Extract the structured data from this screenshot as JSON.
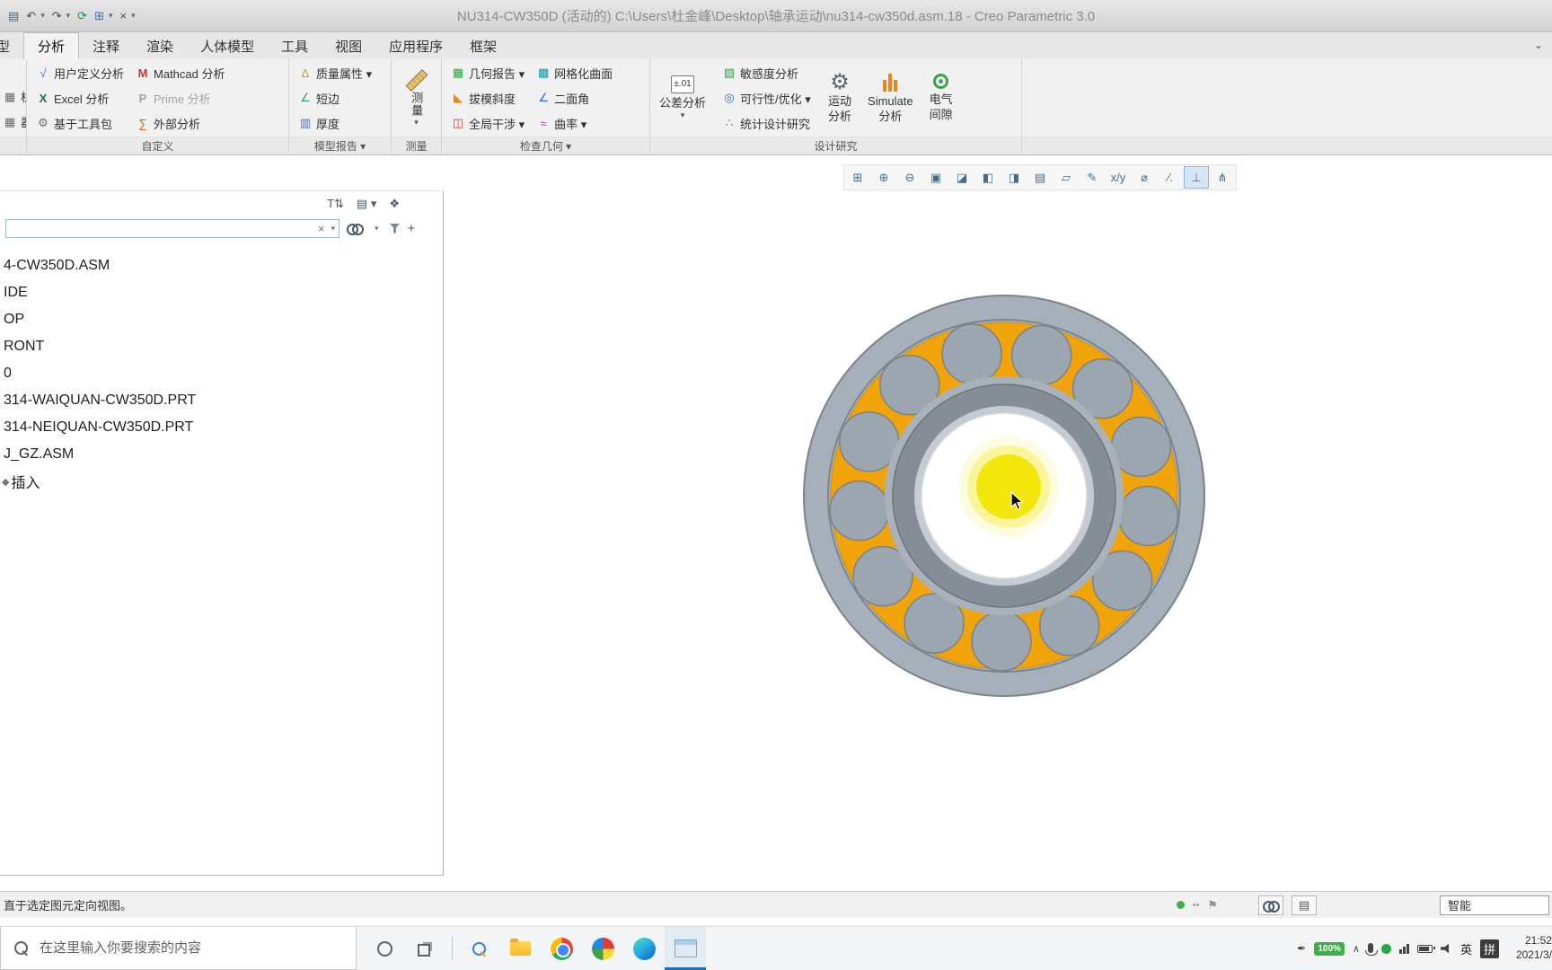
{
  "colors": {
    "bearing_outer": "#a6b0ba",
    "bearing_orange": "#f1a30a",
    "bearing_roller": "#9ba6b0",
    "bearing_gap": "#a9b2bb",
    "bearing_inner_dark": "#858d97",
    "bearing_inner_light": "#c4cbd2",
    "highlight_yellow": "#f2e60a",
    "accent_blue": "#0078d7",
    "status_green": "#3fae49"
  },
  "titlebar": {
    "title": "NU314-CW350D (活动的) C:\\Users\\杜金峰\\Desktop\\轴承运动\\nu314-cw350d.asm.18 - Creo Parametric 3.0",
    "quick_icons": [
      {
        "name": "file-icon",
        "glyph": "▤",
        "icon": "file"
      },
      {
        "name": "undo-button",
        "glyph": "↶",
        "icon": "undo"
      },
      {
        "name": "undo-dropdown",
        "glyph": "▾",
        "icon": "drop"
      },
      {
        "name": "redo-button",
        "glyph": "↷",
        "icon": "redo"
      },
      {
        "name": "redo-dropdown",
        "glyph": "▾",
        "icon": "drop"
      },
      {
        "name": "regenerate-button",
        "glyph": "⟳",
        "icon": "regen"
      },
      {
        "name": "windows-button",
        "glyph": "⊞",
        "icon": "win"
      },
      {
        "name": "windows-dropdown",
        "glyph": "▾",
        "icon": "drop"
      },
      {
        "name": "close-window-button",
        "glyph": "×",
        "icon": "closex"
      },
      {
        "name": "qat-customize-button",
        "glyph": "▾",
        "icon": "drop"
      }
    ]
  },
  "ribbon": {
    "minimize_glyph": "⌄",
    "tabs": [
      {
        "label": "模型",
        "active": false
      },
      {
        "label": "分析",
        "active": true
      },
      {
        "label": "注释",
        "active": false
      },
      {
        "label": "渲染",
        "active": false
      },
      {
        "label": "人体模型",
        "active": false
      },
      {
        "label": "工具",
        "active": false
      },
      {
        "label": "视图",
        "active": false
      },
      {
        "label": "应用程序",
        "active": false
      },
      {
        "label": "框架",
        "active": false
      }
    ],
    "group_labels": {
      "custom": "自定义",
      "report": "模型报告 ▾",
      "measure": "测量",
      "check": "检查几何 ▾",
      "study": "设计研究"
    },
    "clipped_items": [
      {
        "label": "析",
        "glyph": "▦",
        "icon": "frag"
      },
      {
        "label": "器",
        "glyph": "▦",
        "icon": "frag"
      }
    ],
    "custom_col1": [
      {
        "label": "用户定义分析",
        "glyph": "√",
        "icon": "uda"
      },
      {
        "label": "Excel 分析",
        "glyph": "X",
        "icon": "excel"
      },
      {
        "label": "基于工具包",
        "glyph": "⚙",
        "icon": "toolkit"
      }
    ],
    "custom_col2": [
      {
        "label": "Mathcad 分析",
        "glyph": "M",
        "icon": "mathcad"
      },
      {
        "label": "Prime 分析",
        "glyph": "P",
        "icon": "prime",
        "disabled": true
      },
      {
        "label": "外部分析",
        "glyph": "∑",
        "icon": "external"
      }
    ],
    "report_col": [
      {
        "label": "质量属性 ▾",
        "glyph": "∆",
        "icon": "mass"
      },
      {
        "label": "短边",
        "glyph": "∠",
        "icon": "short-edge"
      },
      {
        "label": "厚度",
        "glyph": "▥",
        "icon": "thickness"
      }
    ],
    "check_col1": [
      {
        "label": "几何报告 ▾",
        "glyph": "▦",
        "icon": "geom-report"
      },
      {
        "label": "拔模斜度",
        "glyph": "◣",
        "icon": "draft"
      },
      {
        "label": "全局干涉 ▾",
        "glyph": "◫",
        "icon": "interference"
      }
    ],
    "check_col2": [
      {
        "label": "网格化曲面",
        "glyph": "▩",
        "icon": "mesh"
      },
      {
        "label": "二面角",
        "glyph": "∠",
        "icon": "dihedral"
      },
      {
        "label": "曲率 ▾",
        "glyph": "≈",
        "icon": "curvature"
      }
    ],
    "study_col": [
      {
        "label": "敏感度分析",
        "glyph": "▧",
        "icon": "sensitivity"
      },
      {
        "label": "可行性/优化 ▾",
        "glyph": "◎",
        "icon": "feasibility"
      },
      {
        "label": "统计设计研究",
        "glyph": "∴",
        "icon": "statistical"
      }
    ],
    "measure": {
      "label": "测量",
      "arrow": "▾"
    },
    "tolerance": {
      "icon_text": "±.01",
      "label": "公差分析",
      "arrow": "▾"
    },
    "motion": {
      "glyph": "⚙",
      "line1": "运动",
      "line2": "分析"
    },
    "simulate": {
      "line1": "Simulate",
      "line2": "分析"
    },
    "clearance": {
      "line1": "电气",
      "line2": "间隙"
    }
  },
  "graphics_toolbar": {
    "items": [
      {
        "name": "zoom-window-icon",
        "glyph": "⊞"
      },
      {
        "name": "zoom-in-icon",
        "glyph": "⊕"
      },
      {
        "name": "zoom-out-icon",
        "glyph": "⊖"
      },
      {
        "name": "refit-icon",
        "glyph": "▣"
      },
      {
        "name": "repaint-icon",
        "glyph": "◪"
      },
      {
        "name": "display-style-icon",
        "glyph": "◧"
      },
      {
        "name": "section-icon",
        "glyph": "◨"
      },
      {
        "name": "saved-views-icon",
        "glyph": "▤"
      },
      {
        "name": "datum-plane-icon",
        "glyph": "▱"
      },
      {
        "name": "annotations-icon",
        "glyph": "✎"
      },
      {
        "name": "xy-display-icon",
        "glyph": "x/y"
      },
      {
        "name": "diameter-icon",
        "glyph": "⌀"
      },
      {
        "name": "dims-display-icon",
        "glyph": "∕."
      },
      {
        "name": "perpendicular-icon",
        "glyph": "⊥",
        "pressed": true
      },
      {
        "name": "linkage-icon",
        "glyph": "⋔"
      }
    ]
  },
  "tree": {
    "toolbar_icons": [
      {
        "name": "tree-settings-icon",
        "glyph": "T⇅"
      },
      {
        "name": "tree-show-icon",
        "glyph": "▤ ▾"
      },
      {
        "name": "tree-cascade-icon",
        "glyph": "❖"
      }
    ],
    "clear_glyph": "×",
    "drop_glyph": "▾",
    "plus_glyph": "+",
    "items": [
      {
        "label": "4-CW350D.ASM"
      },
      {
        "label": "IDE"
      },
      {
        "label": "OP"
      },
      {
        "label": "RONT"
      },
      {
        "label": "0"
      },
      {
        "label": "314-WAIQUAN-CW350D.PRT"
      },
      {
        "label": "314-NEIQUAN-CW350D.PRT"
      },
      {
        "label": "J_GZ.ASM"
      },
      {
        "label": "插入",
        "glyph": "◆"
      }
    ]
  },
  "viewport": {
    "bearing": {
      "roller_count": 13
    }
  },
  "status_bar": {
    "message": "直于选定图元定向视图。",
    "dots_glyph": "••",
    "flag_glyph": "⚑",
    "report_glyph": "▤",
    "filter_label": "智能"
  },
  "taskbar": {
    "search_placeholder": "在这里输入你要搜索的内容",
    "tray": {
      "pen_glyph": "✒",
      "battery": "100%",
      "chevron_glyph": "∧",
      "lang": "英",
      "ime": "拼",
      "time": "21:52",
      "date": "2021/3/"
    }
  }
}
